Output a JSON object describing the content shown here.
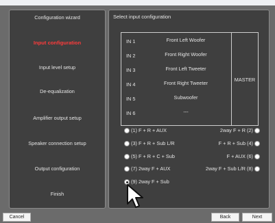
{
  "nav": {
    "items": [
      {
        "label": "Configuration wizard",
        "active": false
      },
      {
        "label": "Input configuration",
        "active": true
      },
      {
        "label": "Input level setup",
        "active": false
      },
      {
        "label": "De-equalization",
        "active": false
      },
      {
        "label": "Amplifier output setup",
        "active": false
      },
      {
        "label": "Speaker connection setup",
        "active": false
      },
      {
        "label": "Output configuration",
        "active": false
      },
      {
        "label": "Finish",
        "active": false
      }
    ]
  },
  "main": {
    "title": "Select input configuration",
    "table": {
      "rows": [
        {
          "in": "IN 1",
          "name": "Front Left Woofer"
        },
        {
          "in": "IN 2",
          "name": "Front Right Woofer"
        },
        {
          "in": "IN 3",
          "name": "Front Left Tweeter"
        },
        {
          "in": "IN 4",
          "name": "Front Right Tweeter"
        },
        {
          "in": "IN 5",
          "name": "Subwoofer"
        },
        {
          "in": "IN 6",
          "name": "---"
        }
      ],
      "master": "MASTER"
    },
    "options_left": [
      {
        "label": "(1) F + R + AUX",
        "checked": false
      },
      {
        "label": "(3) F + R + Sub L/R",
        "checked": false
      },
      {
        "label": "(5) F + R + C + Sub",
        "checked": false
      },
      {
        "label": "(7) 2way F + AUX",
        "checked": false
      },
      {
        "label": "(9) 2way F + Sub",
        "checked": true
      }
    ],
    "options_right": [
      {
        "label": "2way F + R (2)",
        "checked": false
      },
      {
        "label": "F + R + Sub (4)",
        "checked": false
      },
      {
        "label": "F + AUX (6)",
        "checked": false
      },
      {
        "label": "2way F + Sub L/R (8)",
        "checked": false
      }
    ]
  },
  "footer": {
    "cancel_label": "Cancel",
    "back_label": "Back",
    "next_label": "Next"
  },
  "colors": {
    "active_nav": "#ff3b3b",
    "panel_bg": "#3f3f3f",
    "frame_bg": "#6b6b6b"
  }
}
